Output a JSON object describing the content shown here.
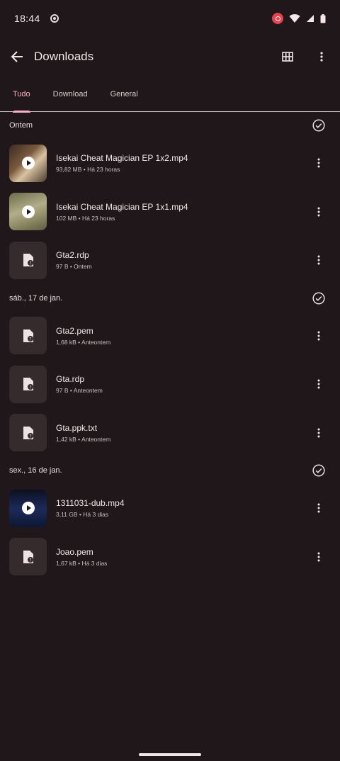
{
  "status_bar": {
    "time": "18:44"
  },
  "app_bar": {
    "title": "Downloads"
  },
  "tabs": [
    {
      "label": "Tudo",
      "active": true
    },
    {
      "label": "Download",
      "active": false
    },
    {
      "label": "General",
      "active": false
    }
  ],
  "sections": [
    {
      "header": "Ontem",
      "items": [
        {
          "name": "Isekai Cheat Magician EP 1x2.mp4",
          "meta": "93,82 MB • Há 23 horas",
          "type": "video"
        },
        {
          "name": "Isekai Cheat Magician EP 1x1.mp4",
          "meta": "102 MB • Há 23 horas",
          "type": "video"
        },
        {
          "name": "Gta2.rdp",
          "meta": "97 B • Ontem",
          "type": "file"
        }
      ]
    },
    {
      "header": "sáb., 17 de jan.",
      "items": [
        {
          "name": "Gta2.pem",
          "meta": "1,68 kB • Anteontem",
          "type": "file"
        },
        {
          "name": "Gta.rdp",
          "meta": "97 B • Anteontem",
          "type": "file"
        },
        {
          "name": "Gta.ppk.txt",
          "meta": "1,42 kB • Anteontem",
          "type": "file"
        }
      ]
    },
    {
      "header": "sex., 16 de jan.",
      "items": [
        {
          "name": "1311031-dub.mp4",
          "meta": "3,11 GB • Há 3 dias",
          "type": "video"
        },
        {
          "name": "Joao.pem",
          "meta": "1,67 kB • Há 3 dias",
          "type": "file"
        }
      ]
    }
  ],
  "colors": {
    "background": "#1f1719",
    "accent": "#ffb1c4"
  }
}
